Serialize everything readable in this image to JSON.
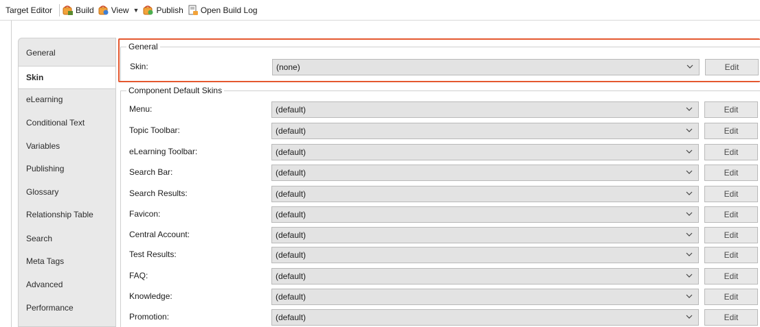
{
  "toolbar": {
    "title": "Target Editor",
    "build_label": "Build",
    "view_label": "View",
    "publish_label": "Publish",
    "open_build_log_label": "Open Build Log"
  },
  "sidebar": {
    "items": [
      {
        "label": "General",
        "active": false
      },
      {
        "label": "Skin",
        "active": true
      },
      {
        "label": "eLearning",
        "active": false
      },
      {
        "label": "Conditional Text",
        "active": false
      },
      {
        "label": "Variables",
        "active": false
      },
      {
        "label": "Publishing",
        "active": false
      },
      {
        "label": "Glossary",
        "active": false
      },
      {
        "label": "Relationship Table",
        "active": false
      },
      {
        "label": "Search",
        "active": false
      },
      {
        "label": "Meta Tags",
        "active": false
      },
      {
        "label": "Advanced",
        "active": false
      },
      {
        "label": "Performance",
        "active": false
      }
    ]
  },
  "general_group": {
    "legend": "General",
    "skin_label": "Skin:",
    "skin_value": "(none)",
    "edit_label": "Edit"
  },
  "component_group": {
    "legend": "Component Default Skins",
    "rows": [
      {
        "label": "Menu:",
        "value": "(default)",
        "edit": "Edit"
      },
      {
        "label": "Topic Toolbar:",
        "value": "(default)",
        "edit": "Edit"
      },
      {
        "label": "eLearning Toolbar:",
        "value": "(default)",
        "edit": "Edit"
      },
      {
        "label": "Search Bar:",
        "value": "(default)",
        "edit": "Edit"
      },
      {
        "label": "Search Results:",
        "value": "(default)",
        "edit": "Edit"
      },
      {
        "label": "Favicon:",
        "value": "(default)",
        "edit": "Edit"
      },
      {
        "label": "Central Account:",
        "value": "(default)",
        "edit": "Edit"
      },
      {
        "label": "Test Results:",
        "value": "(default)",
        "edit": "Edit"
      },
      {
        "label": "FAQ:",
        "value": "(default)",
        "edit": "Edit"
      },
      {
        "label": "Knowledge:",
        "value": "(default)",
        "edit": "Edit"
      },
      {
        "label": "Promotion:",
        "value": "(default)",
        "edit": "Edit"
      }
    ]
  },
  "colors": {
    "highlight_border": "#e4572e",
    "select_bg": "#e3e3e3",
    "sidebar_bg": "#e9e9e9"
  },
  "icons": {
    "build": "build-icon",
    "view": "view-icon",
    "publish": "publish-icon",
    "open_build_log": "build-log-icon",
    "select_arrow": "chevron-down-icon"
  }
}
